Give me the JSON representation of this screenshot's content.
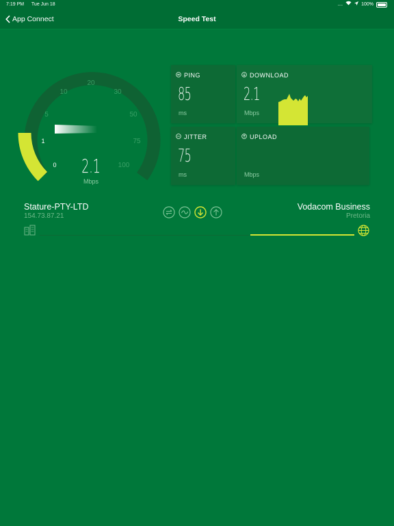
{
  "status_bar": {
    "time": "7:19 PM",
    "date": "Tue Jun 18",
    "battery": "100%"
  },
  "nav": {
    "back_label": "App Connect",
    "title": "Speed Test"
  },
  "gauge": {
    "scale_labels": [
      "0",
      "1",
      "5",
      "10",
      "20",
      "30",
      "50",
      "75",
      "100"
    ],
    "value": "2.1",
    "unit": "Mbps",
    "needle_value": 2.1
  },
  "metrics": {
    "ping": {
      "label": "PING",
      "value": "85",
      "unit": "ms"
    },
    "download": {
      "label": "DOWNLOAD",
      "value": "2.1",
      "unit": "Mbps"
    },
    "jitter": {
      "label": "JITTER",
      "value": "75",
      "unit": "ms"
    },
    "upload": {
      "label": "UPLOAD",
      "value": "",
      "unit": "Mbps"
    }
  },
  "isp": {
    "name": "Stature-PTY-LTD",
    "ip": "154.73.87.21"
  },
  "server": {
    "name": "Vodacom Business",
    "location": "Pretoria"
  },
  "test_modes": [
    "ping-icon",
    "jitter-icon",
    "download-icon",
    "upload-icon"
  ],
  "colors": {
    "background": "#00783a",
    "accent": "#d4e534",
    "panel": "#0d6a35"
  }
}
